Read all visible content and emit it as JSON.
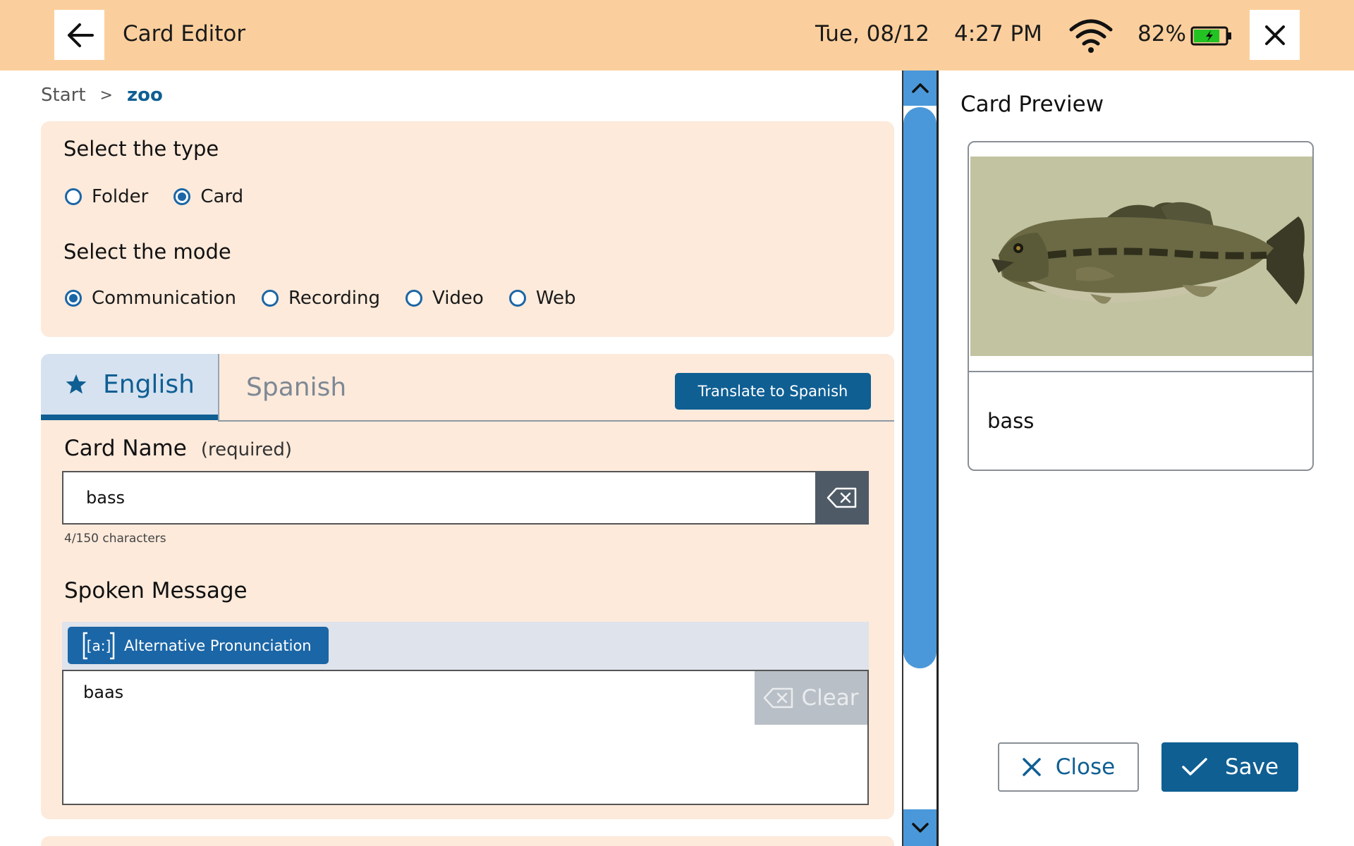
{
  "header": {
    "title": "Card Editor",
    "date": "Tue,  08/12",
    "time": "4:27 PM",
    "battery_percent": "82%",
    "battery_level": 0.82,
    "icons": {
      "back": "arrow-left-icon",
      "wifi": "wifi-icon",
      "battery": "battery-charging-icon",
      "close": "close-icon"
    }
  },
  "breadcrumb": {
    "start": "Start",
    "separator": ">",
    "current": "zoo"
  },
  "type_section": {
    "heading": "Select the type",
    "options": [
      {
        "label": "Folder",
        "checked": false
      },
      {
        "label": "Card",
        "checked": true
      }
    ]
  },
  "mode_section": {
    "heading": "Select the mode",
    "options": [
      {
        "label": "Communication",
        "checked": true
      },
      {
        "label": "Recording",
        "checked": false
      },
      {
        "label": "Video",
        "checked": false
      },
      {
        "label": "Web",
        "checked": false
      }
    ]
  },
  "language_tabs": {
    "tabs": [
      {
        "label": "English",
        "active": true,
        "icon": "star-icon"
      },
      {
        "label": "Spanish",
        "active": false
      }
    ],
    "translate_button": "Translate to Spanish"
  },
  "card_name": {
    "heading": "Card Name",
    "required_label": "(required)",
    "value": "bass",
    "char_count": "4/150 characters"
  },
  "spoken_message": {
    "heading": "Spoken Message",
    "alt_pronunciation_button": "Alternative Pronunciation",
    "alt_icon_text": "[a:]",
    "value": "baas",
    "clear_label": "Clear"
  },
  "preview": {
    "heading": "Card Preview",
    "label": "bass",
    "image_subject": "largemouth bass fish"
  },
  "footer": {
    "close_label": "Close",
    "save_label": "Save"
  },
  "colors": {
    "header_bg": "#fbcf9d",
    "panel_bg": "#fdeadb",
    "accent": "#0f5f93",
    "scrollbar": "#4a98d9",
    "battery_fill": "#22c322"
  }
}
